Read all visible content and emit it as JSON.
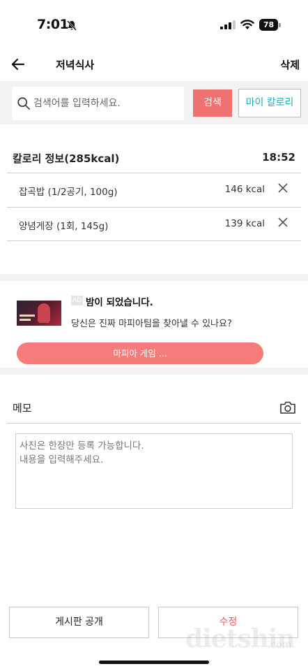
{
  "status": {
    "time": "7:01",
    "battery": "78"
  },
  "header": {
    "title": "저녁식사",
    "delete_label": "삭제"
  },
  "search": {
    "placeholder": "검색어를 입력하세요.",
    "button_label": "검색",
    "my_calorie_label": "마이 칼로리"
  },
  "calorie": {
    "title": "칼로리 정보(285kcal)",
    "time": "18:52",
    "items": [
      {
        "name": "잡곡밥 (1/2공기, 100g)",
        "kcal": "146 kcal"
      },
      {
        "name": "양념게장 (1회, 145g)",
        "kcal": "139 kcal"
      }
    ]
  },
  "ad": {
    "badge": "AD",
    "title": "밤이 되었습니다.",
    "description": "당신은 진짜 마피아팀을 찾아낼 수 있나요?",
    "cta": "마피아 게임 ..."
  },
  "memo": {
    "label": "메모",
    "placeholder": "사진은 한장만 등록 가능합니다.\n내용을 입력해주세요."
  },
  "buttons": {
    "public": "게시판 공개",
    "edit": "수정"
  },
  "watermark": {
    "main": "dietshin",
    "sub": ".com"
  },
  "icons": [
    "bell-off-icon",
    "signal-icon",
    "wifi-icon",
    "battery-icon",
    "back-arrow-icon",
    "search-icon",
    "close-icon",
    "camera-icon"
  ],
  "colors": {
    "accent_red": "#f07171",
    "teal": "#28a9b7",
    "ad_button": "#f57c7b",
    "edit_text": "#f05b5b"
  }
}
